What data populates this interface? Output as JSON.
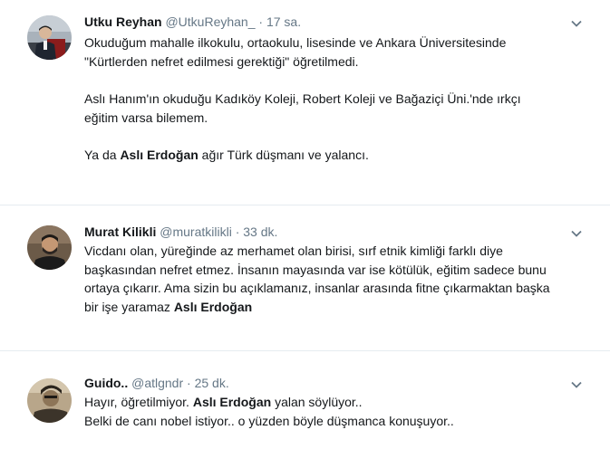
{
  "tweets": [
    {
      "fullname": "Utku Reyhan",
      "username": "@UtkuReyhan_",
      "separator": "·",
      "time": "17 sa.",
      "paragraphs": [
        {
          "lines": [
            {
              "parts": [
                "Okuduğum mahalle ilkokulu, ortaokulu, lisesinde ve Ankara Üniversitesinde"
              ]
            },
            {
              "parts": [
                "\"Kürtlerden nefret edilmesi gerektiği\" öğretilmedi."
              ]
            }
          ]
        },
        {
          "lines": [
            {
              "parts": [
                "Aslı Hanım'ın okuduğu Kadıköy Koleji, Robert Koleji ve Bağaziçi Üni.'nde ırkçı"
              ]
            },
            {
              "parts": [
                "eğitim varsa bilemem."
              ]
            }
          ]
        },
        {
          "lines": [
            {
              "parts": [
                "Ya da ",
                "Aslı Erdoğan",
                " ağır Türk düşmanı ve yalancı."
              ]
            }
          ]
        }
      ]
    },
    {
      "fullname": "Murat Kilikli",
      "username": "@muratkilikli",
      "separator": "·",
      "time": "33 dk.",
      "paragraphs": [
        {
          "lines": [
            {
              "parts": [
                "Vicdanı olan, yüreğinde az merhamet olan birisi, sırf etnik kimliği farklı diye"
              ]
            },
            {
              "parts": [
                "başkasından nefret etmez. İnsanın mayasında var ise kötülük, eğitim sadece bunu"
              ]
            },
            {
              "parts": [
                "ortaya çıkarır. Ama sizin bu açıklamanız, insanlar arasında fitne çıkarmaktan başka"
              ]
            },
            {
              "parts": [
                "bir işe yaramaz ",
                "Aslı Erdoğan"
              ]
            }
          ]
        }
      ]
    },
    {
      "fullname": "Guido..",
      "username": "@atlgndr",
      "separator": "·",
      "time": "25 dk.",
      "paragraphs": [
        {
          "lines": [
            {
              "parts": [
                "Hayır, öğretilmiyor. ",
                "Aslı Erdoğan",
                " yalan söylüyor.."
              ]
            },
            {
              "parts": [
                "Belki de canı nobel istiyor.. o yüzden böyle düşmanca konuşuyor.."
              ]
            }
          ]
        }
      ]
    }
  ],
  "icons": {
    "avatar_1": "avatar-photo-man-at-podium",
    "avatar_2": "avatar-photo-man",
    "avatar_3": "avatar-photo-sepia-man",
    "menu": "chevron-down-icon"
  },
  "colors": {
    "text": "#14171a",
    "secondary": "#657786",
    "divider": "#e6ecf0",
    "background": "#ffffff"
  }
}
